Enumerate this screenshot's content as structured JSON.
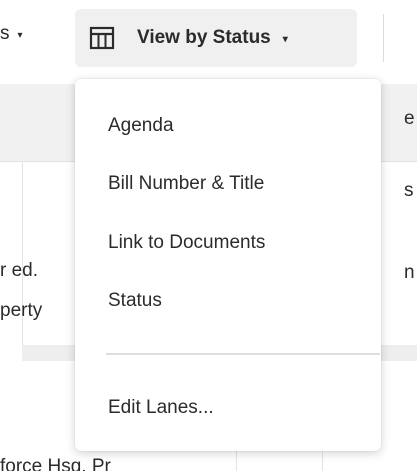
{
  "toolbar": {
    "prev_dropdown_label": "s",
    "view_button_label": "View by Status",
    "caret": "▾"
  },
  "board": {
    "card_lines": [
      "r ed.",
      "perty"
    ],
    "right_edge_chars": [
      "e",
      "s",
      "n"
    ],
    "bottom_text": "force Hsg. Pr"
  },
  "menu": {
    "items": [
      {
        "label": "Agenda"
      },
      {
        "label": "Bill Number & Title"
      },
      {
        "label": "Link to Documents"
      },
      {
        "label": "Status"
      }
    ],
    "footer_item": {
      "label": "Edit Lanes..."
    }
  },
  "icons": {
    "view_icon": "table-icon",
    "caret_icon": "chevron-down-icon"
  },
  "colors": {
    "button_bg": "#f0f0f0",
    "header_band": "#f1f1f1",
    "text": "#2b2b2b"
  }
}
